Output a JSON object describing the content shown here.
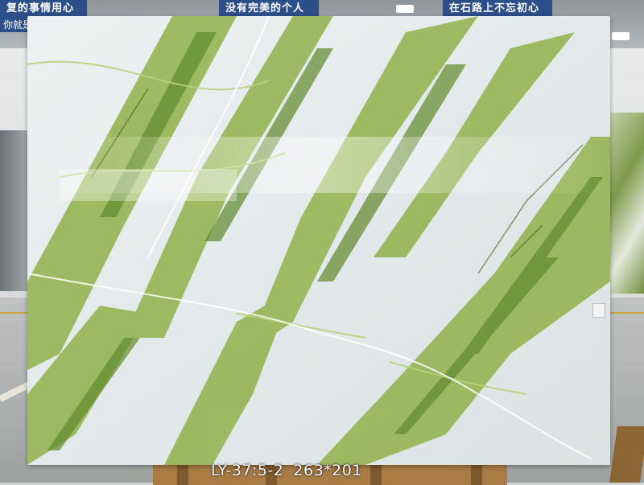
{
  "banners": {
    "left": "复的事情用心做",
    "left_line2": "你就是",
    "middle": "没有完美的个人",
    "right": "在石路上不忘初心"
  },
  "slab": {
    "code": "LY-37:5-2",
    "size": "263*201"
  },
  "colors": {
    "marble_base": "#e9edef",
    "vein_green": "#7fa33a",
    "vein_dark": "#4f6f26",
    "banner_blue": "#2c4f8a"
  }
}
